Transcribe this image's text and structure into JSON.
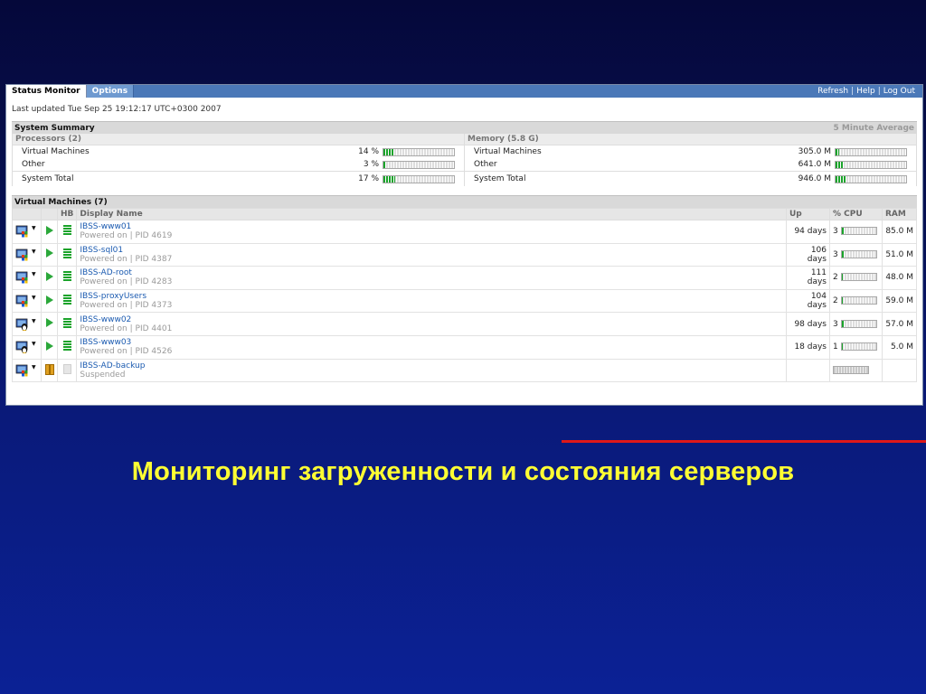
{
  "tabs": [
    {
      "label": "Status Monitor",
      "active": true
    },
    {
      "label": "Options",
      "active": false
    }
  ],
  "toplinks": [
    "Refresh",
    "Help",
    "Log Out"
  ],
  "last_updated": "Last updated Tue Sep 25 19:12:17 UTC+0300 2007",
  "summary": {
    "title": "System Summary",
    "avg_label": "5 Minute Average",
    "processors": {
      "title": "Processors (2)",
      "rows": [
        {
          "label": "Virtual Machines",
          "value": "14 %",
          "fill_percent": 14
        },
        {
          "label": "Other",
          "value": "3 %",
          "fill_percent": 3
        },
        {
          "label": "System Total",
          "value": "17 %",
          "fill_percent": 17
        }
      ]
    },
    "memory": {
      "title": "Memory (5.8 G)",
      "rows": [
        {
          "label": "Virtual Machines",
          "value": "305.0 M",
          "fill_percent": 5
        },
        {
          "label": "Other",
          "value": "641.0 M",
          "fill_percent": 11
        },
        {
          "label": "System Total",
          "value": "946.0 M",
          "fill_percent": 16
        }
      ]
    }
  },
  "vms": {
    "title": "Virtual Machines (7)",
    "headers": {
      "hb": "HB",
      "name": "Display Name",
      "up": "Up",
      "cpu": "% CPU",
      "ram": "RAM"
    },
    "rows": [
      {
        "name": "IBSS-www01",
        "status": "Powered on",
        "pid": "PID 4619",
        "up": "94 days",
        "cpu": "3",
        "cpu_fill": 3,
        "ram": "85.0 M",
        "state": "running",
        "os": "windows"
      },
      {
        "name": "IBSS-sql01",
        "status": "Powered on",
        "pid": "PID 4387",
        "up": "106 days",
        "cpu": "3",
        "cpu_fill": 3,
        "ram": "51.0 M",
        "state": "running",
        "os": "windows"
      },
      {
        "name": "IBSS-AD-root",
        "status": "Powered on",
        "pid": "PID 4283",
        "up": "111 days",
        "cpu": "2",
        "cpu_fill": 2,
        "ram": "48.0 M",
        "state": "running",
        "os": "windows"
      },
      {
        "name": "IBSS-proxyUsers",
        "status": "Powered on",
        "pid": "PID 4373",
        "up": "104 days",
        "cpu": "2",
        "cpu_fill": 2,
        "ram": "59.0 M",
        "state": "running",
        "os": "windows"
      },
      {
        "name": "IBSS-www02",
        "status": "Powered on",
        "pid": "PID 4401",
        "up": "98 days",
        "cpu": "3",
        "cpu_fill": 3,
        "ram": "57.0 M",
        "state": "running",
        "os": "linux"
      },
      {
        "name": "IBSS-www03",
        "status": "Powered on",
        "pid": "PID 4526",
        "up": "18 days",
        "cpu": "1",
        "cpu_fill": 1,
        "ram": "5.0 M",
        "state": "running",
        "os": "linux"
      },
      {
        "name": "IBSS-AD-backup",
        "status": "Suspended",
        "pid": "",
        "up": "",
        "cpu": "",
        "cpu_fill": 0,
        "ram": "",
        "state": "suspended",
        "os": "windows"
      }
    ]
  },
  "caption": "Мониторинг загруженности и состояния серверов"
}
